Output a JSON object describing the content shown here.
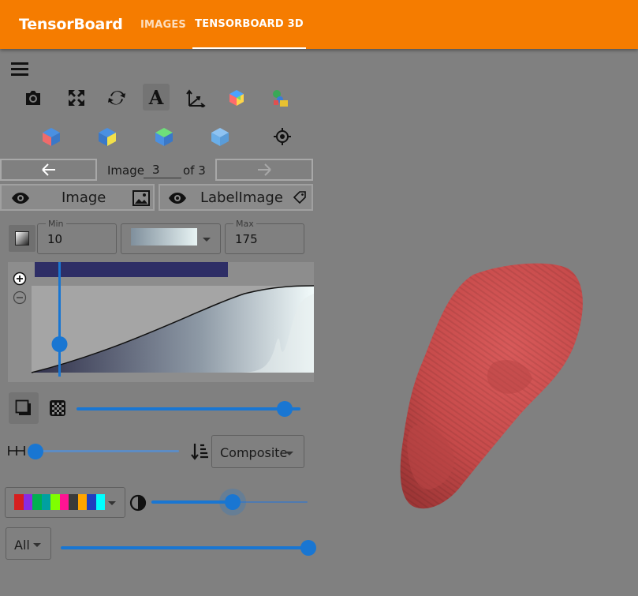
{
  "header": {
    "brand": "TensorBoard",
    "tabs": [
      {
        "label": "IMAGES",
        "active": false
      },
      {
        "label": "TENSORBOARD 3D",
        "active": true
      }
    ],
    "accent": "#f57c00"
  },
  "toolbar": {
    "row1": [
      "menu-icon",
      "camera-icon",
      "fullscreen-icon",
      "reset-view-icon",
      "text-annotation-icon",
      "axes-icon",
      "multi-color-cube-icon",
      "colormap-icon"
    ],
    "row2": [
      "cube-red-face-icon",
      "cube-yellow-face-icon",
      "cube-green-face-icon",
      "cube-plain-icon",
      "target-icon"
    ]
  },
  "navigator": {
    "prefix": "Image",
    "current": "3",
    "suffix": "of 3"
  },
  "layers": {
    "image_label": "Image",
    "label_image_label": "LabelImage"
  },
  "range": {
    "min_label": "Min",
    "min_value": "10",
    "max_label": "Max",
    "max_value": "175",
    "colormap_gradient": [
      "#7f8f9c",
      "#e8f4f4"
    ]
  },
  "transfer": {
    "band_color": "#2e2e66",
    "opacity_level": 0.93,
    "gradient_opacity_level": 0.01,
    "blend_mode": "Composite",
    "label_opacity_level": 0.52,
    "label_select": "All",
    "label_slider_level": 1.0,
    "label_palette": [
      "#d61f1f",
      "#8a2be2",
      "#00b050",
      "#00a0a0",
      "#7fff00",
      "#ff1493",
      "#3a3a3a",
      "#ffa500",
      "#1f3fbf",
      "#00ffff"
    ]
  },
  "volume_color": "#c85050"
}
